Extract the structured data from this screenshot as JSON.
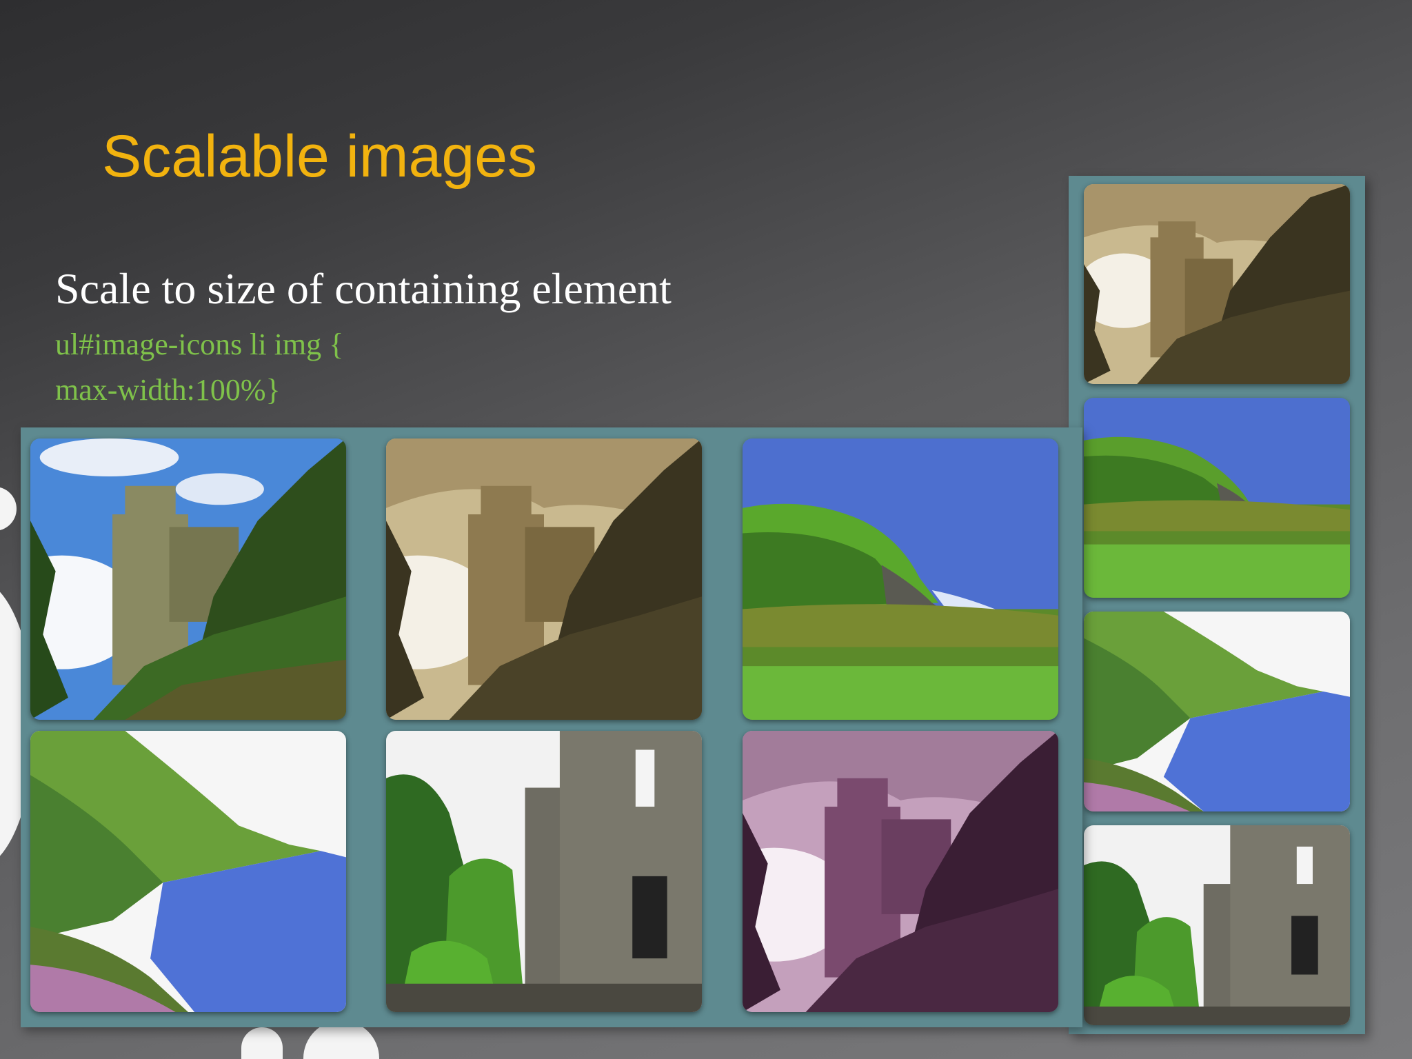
{
  "slide": {
    "title": "Scalable images",
    "subtitle": "Scale to size of containing element",
    "code": {
      "line1": "ul#image-icons li img {",
      "line2": "max-width:100%}"
    }
  },
  "colors": {
    "title": "#f2b30f",
    "code": "#7fc24a",
    "grid_background": "#5e8a90"
  },
  "image_icons_main": [
    {
      "name": "castle-cliff-color"
    },
    {
      "name": "castle-cliff-sepia"
    },
    {
      "name": "coast-cliffs"
    },
    {
      "name": "coastline-lake"
    },
    {
      "name": "ruined-tower"
    },
    {
      "name": "castle-cliff-purple"
    }
  ],
  "image_icons_side": [
    {
      "name": "castle-cliff-sepia"
    },
    {
      "name": "coast-cliffs"
    },
    {
      "name": "coastline-lake"
    },
    {
      "name": "ruined-tower"
    }
  ]
}
